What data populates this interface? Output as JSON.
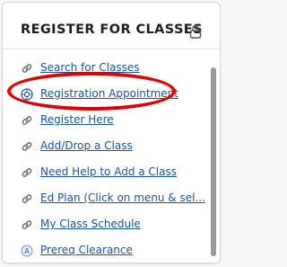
{
  "panel": {
    "title": "REGISTER FOR CLASSES",
    "lock_icon": "lock-icon"
  },
  "links": [
    {
      "label": "Search for Classes",
      "icon": "link-icon"
    },
    {
      "label": "Registration Appointment",
      "icon": "gear-circle-icon"
    },
    {
      "label": "Register Here",
      "icon": "link-icon"
    },
    {
      "label": "Add/Drop a Class",
      "icon": "link-icon"
    },
    {
      "label": "Need Help to Add a Class",
      "icon": "link-icon"
    },
    {
      "label": "Ed Plan (Click on menu & sel...",
      "icon": "link-icon"
    },
    {
      "label": "My Class Schedule",
      "icon": "link-icon"
    },
    {
      "label": "Prereq Clearance",
      "icon": "circle-a-icon"
    }
  ],
  "colors": {
    "link": "#1a55a3",
    "highlight_oval": "#e00000",
    "scrollbar": "#9a9a9a"
  }
}
